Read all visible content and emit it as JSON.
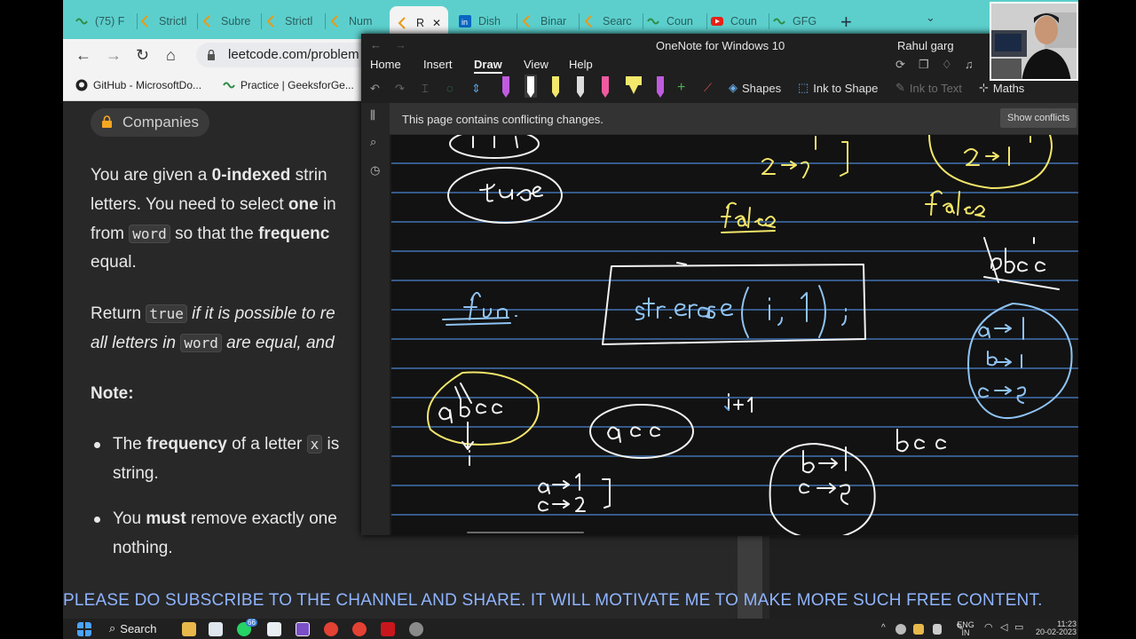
{
  "browser": {
    "tabs": [
      {
        "label": "(75) F",
        "icon": "gfg-icon"
      },
      {
        "label": "Strictl",
        "icon": "leetcode-icon"
      },
      {
        "label": "Subre",
        "icon": "leetcode-icon"
      },
      {
        "label": "Strictl",
        "icon": "leetcode-icon"
      },
      {
        "label": "Num",
        "icon": "leetcode-icon"
      },
      {
        "label": "R",
        "icon": "leetcode-icon",
        "active": true
      },
      {
        "label": "Dish",
        "icon": "linkedin-icon"
      },
      {
        "label": "Binar",
        "icon": "leetcode-icon"
      },
      {
        "label": "Searc",
        "icon": "leetcode-icon"
      },
      {
        "label": "Coun",
        "icon": "gfg-icon"
      },
      {
        "label": "Coun",
        "icon": "youtube-icon"
      },
      {
        "label": "GFG",
        "icon": "gfg-icon"
      }
    ],
    "close_glyph": "✕",
    "new_tab_glyph": "+",
    "tab_menu_glyph": "⌄",
    "url": "leetcode.com/problem",
    "bookmarks": [
      {
        "label": "GitHub - MicrosoftDo...",
        "icon": "github-icon"
      },
      {
        "label": "Practice | GeeksforGe...",
        "icon": "gfg-icon"
      }
    ]
  },
  "leetcode": {
    "companies_label": "Companies",
    "para1": {
      "l1_a": "You are given a ",
      "l1_b": "0-indexed",
      "l1_c": " strin",
      "l2_a": "letters. You need to select ",
      "l2_b": "one",
      "l2_c": " in",
      "l3_a": "from ",
      "l3_code": "word",
      "l3_b": " so that the ",
      "l3_c": "frequenc",
      "l4": "equal."
    },
    "para2": {
      "l1_a": "Return ",
      "l1_code": "true",
      "l1_b": " if it is possible to re",
      "l2_a": "all letters in ",
      "l2_code": "word",
      "l2_b": " are equal, and"
    },
    "note_label": "Note:",
    "bullets": {
      "b1_a": "The ",
      "b1_b": "frequency",
      "b1_c": " of a letter ",
      "b1_code": "x",
      "b1_d": " is",
      "b1_l2": "string.",
      "b2_a": "You ",
      "b2_b": "must",
      "b2_c": " remove exactly one",
      "b2_l2": "nothing."
    }
  },
  "onenote": {
    "title": "OneNote for Windows 10",
    "user": "Rahul garg",
    "tabs": [
      "Home",
      "Insert",
      "Draw",
      "View",
      "Help"
    ],
    "active_tab": "Draw",
    "ribbon": {
      "shapes": "Shapes",
      "ink_to_shape": "Ink to Shape",
      "ink_to_text": "Ink to Text",
      "maths": "Maths"
    },
    "banner_text": "This page contains conflicting changes.",
    "show_conflicts": "Show conflicts",
    "pen_colors": [
      "#c05be0",
      "#ffffff",
      "#f3e86b",
      "#ffffff",
      "#f05aa0",
      "#f3e86b",
      "#c05be0"
    ],
    "ink_colors": {
      "white": "#f2f2f2",
      "yellow": "#f2e56a",
      "blue": "#8fc3f2"
    }
  },
  "marquee": "PLEASE DO SUBSCRIBE TO THE CHANNEL AND SHARE. IT WILL MOTIVATE ME TO MAKE MORE SUCH FREE CONTENT.",
  "taskbar": {
    "search_label": "Search",
    "whatsapp_badge": "66",
    "lang_top": "ENG",
    "lang_bottom": "IN",
    "time": "11:23",
    "date": "20-02-2023"
  }
}
